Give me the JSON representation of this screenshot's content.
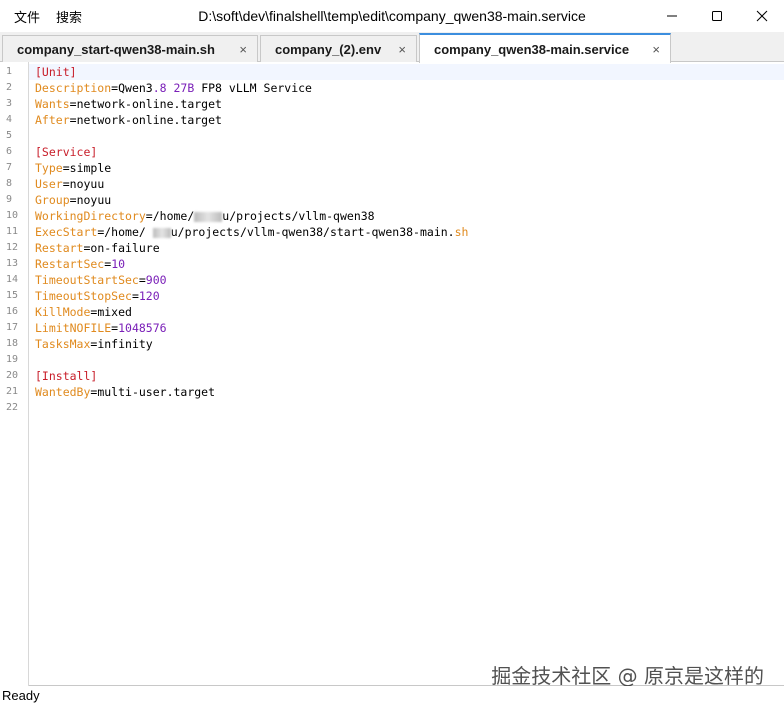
{
  "menu": {
    "file": "文件",
    "search": "搜索"
  },
  "window": {
    "title": "D:\\soft\\dev\\finalshell\\temp\\edit\\company_qwen38-main.service"
  },
  "tabs": [
    {
      "label": "company_start-qwen38-main.sh",
      "close": "×"
    },
    {
      "label": "company_(2).env",
      "close": "×"
    },
    {
      "label": "company_qwen38-main.service",
      "close": "×"
    }
  ],
  "editor": {
    "line_numbers": [
      "1",
      "2",
      "3",
      "4",
      "5",
      "6",
      "7",
      "8",
      "9",
      "10",
      "11",
      "12",
      "13",
      "14",
      "15",
      "16",
      "17",
      "18",
      "19",
      "20",
      "21",
      "22"
    ],
    "lines": {
      "l1_section": "[Unit]",
      "l2_key": "Description",
      "l2_val_a": "Qwen3",
      "l2_num": ".8 27B",
      "l2_val_b": " FP8 vLLM Service",
      "l3_key": "Wants",
      "l3_val": "network-online.target",
      "l4_key": "After",
      "l4_val": "network-online.target",
      "l6_section": "[Service]",
      "l7_key": "Type",
      "l7_val": "simple",
      "l8_key": "User",
      "l8_val": "noyuu",
      "l9_key": "Group",
      "l9_val": "noyuu",
      "l10_key": "WorkingDirectory",
      "l10_val_a": "/home/",
      "l10_val_b": "u/projects/vllm-qwen38",
      "l11_key": "ExecStart",
      "l11_val_a": "/home/ ",
      "l11_val_b": "u/projects/vllm-qwen38/start-qwen38-main.",
      "l11_ext": "sh",
      "l12_key": "Restart",
      "l12_val": "on-failure",
      "l13_key": "RestartSec",
      "l13_num": "10",
      "l14_key": "TimeoutStartSec",
      "l14_num": "900",
      "l15_key": "TimeoutStopSec",
      "l15_num": "120",
      "l16_key": "KillMode",
      "l16_val": "mixed",
      "l17_key": "LimitNOFILE",
      "l17_num": "1048576",
      "l18_key": "TasksMax",
      "l18_val": "infinity",
      "l20_section": "[Install]",
      "l21_key": "WantedBy",
      "l21_val": "multi-user.target"
    },
    "eq": "="
  },
  "watermark": "掘金技术社区 @ 原京是这样的",
  "status": {
    "text": "Ready"
  },
  "colors": {
    "key": "#e08a1e",
    "section": "#c81e2a",
    "number": "#7a1fb8",
    "tab_accent": "#3c8ede"
  }
}
